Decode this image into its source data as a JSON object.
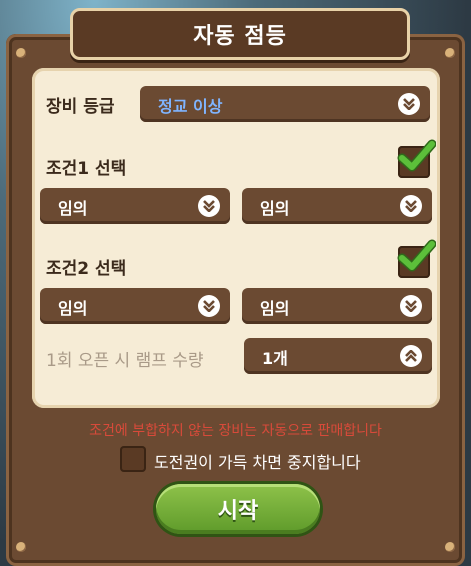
{
  "dialog": {
    "title": "자동 점등"
  },
  "equipment_grade": {
    "label": "장비 등급",
    "value": "정교 이상"
  },
  "condition1": {
    "label": "조건1 선택",
    "checked": true,
    "option_a": "임의",
    "option_b": "임의"
  },
  "condition2": {
    "label": "조건2 선택",
    "checked": true,
    "option_a": "임의",
    "option_b": "임의"
  },
  "lamp_quantity": {
    "label": "1회 오픈 시 램프 수량",
    "value": "1개"
  },
  "warning_text": "조건에 부합하지 않는 장비는 자동으로 판매합니다",
  "stop_option": {
    "label": "도전권이 가득 차면 중지합니다",
    "checked": false
  },
  "start_button": {
    "label": "시작"
  },
  "colors": {
    "frame": "#6b4a32",
    "panel": "#f6ecd6",
    "warning": "#d84a3a",
    "check": "#5cbf3a",
    "start": "#7ab43a",
    "grade_value": "#7fb4ff"
  },
  "icons": {
    "dropdown": "chevron-down-icon",
    "stepper": "chevron-up-icon",
    "check": "checkmark-icon"
  }
}
